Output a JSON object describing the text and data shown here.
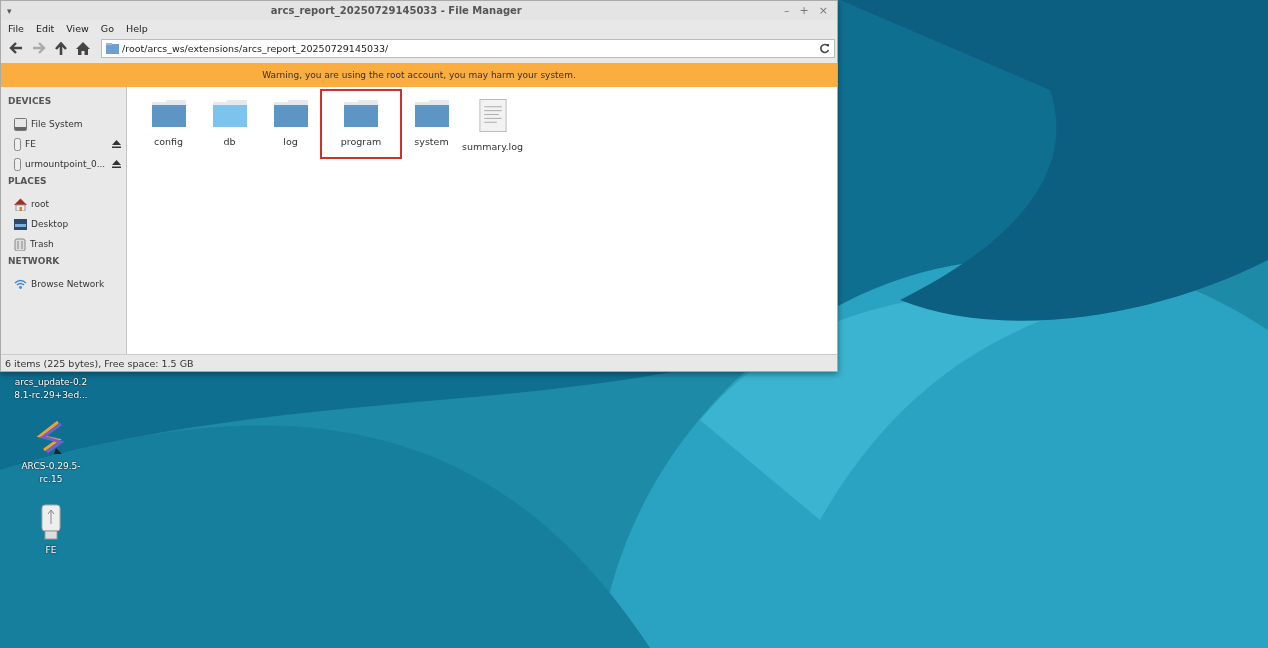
{
  "window": {
    "title": "arcs_report_20250729145033 - File Manager",
    "controls": [
      "–",
      "+",
      "×"
    ],
    "menu_glyph": "▾"
  },
  "menu": [
    "File",
    "Edit",
    "View",
    "Go",
    "Help"
  ],
  "toolbar": {
    "path": "/root/arcs_ws/extensions/arcs_report_20250729145033/"
  },
  "warning": "Warning, you are using the root account, you may harm your system.",
  "sidebar": [
    {
      "heading": "DEVICES",
      "items": [
        {
          "label": "File System",
          "kind": "disk",
          "eject": false
        },
        {
          "label": "FE",
          "kind": "usb",
          "eject": true
        },
        {
          "label": "urmountpoint_0...",
          "kind": "usb",
          "eject": true
        }
      ]
    },
    {
      "heading": "PLACES",
      "items": [
        {
          "label": "root",
          "kind": "home",
          "eject": false
        },
        {
          "label": "Desktop",
          "kind": "desktop",
          "eject": false
        },
        {
          "label": "Trash",
          "kind": "trash",
          "eject": false
        }
      ]
    },
    {
      "heading": "NETWORK",
      "items": [
        {
          "label": "Browse Network",
          "kind": "network",
          "eject": false
        }
      ]
    }
  ],
  "files": [
    {
      "name": "config",
      "kind": "folder",
      "highlighted": false
    },
    {
      "name": "db",
      "kind": "folder-light",
      "highlighted": false
    },
    {
      "name": "log",
      "kind": "folder",
      "highlighted": false
    },
    {
      "name": "program",
      "kind": "folder",
      "highlighted": true
    },
    {
      "name": "system",
      "kind": "folder",
      "highlighted": false
    },
    {
      "name": "summary.log",
      "kind": "document",
      "highlighted": false
    }
  ],
  "status_bar": "6 items (225 bytes), Free space: 1.5 GB",
  "desktop_icons": [
    {
      "lines": [
        "arcs_update-0.2",
        "8.1-rc.29+3ed..."
      ],
      "kind": "hidden"
    },
    {
      "lines": [
        "ARCS-0.29.5-",
        "rc.15"
      ],
      "kind": "arcs"
    },
    {
      "lines": [
        "FE"
      ],
      "kind": "usb"
    }
  ]
}
